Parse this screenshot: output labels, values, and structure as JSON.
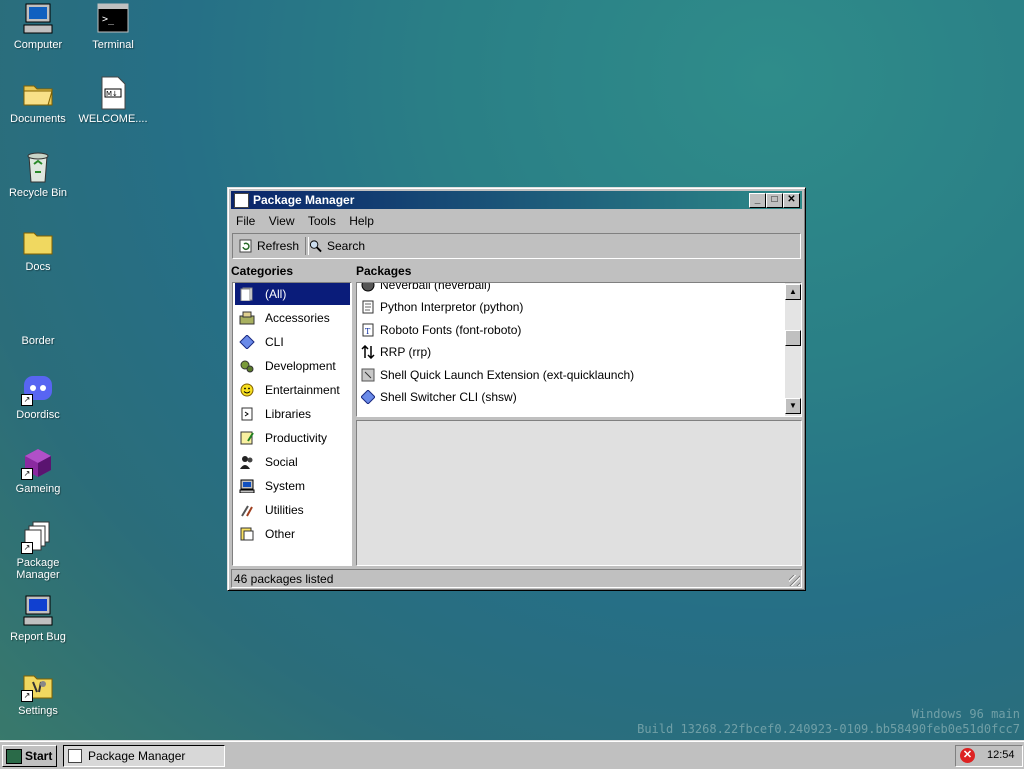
{
  "desktop": {
    "icons": [
      {
        "label": "Computer",
        "icon": "computer-icon"
      },
      {
        "label": "Terminal",
        "icon": "terminal-icon"
      },
      {
        "label": "Documents",
        "icon": "folder-open-icon"
      },
      {
        "label": "WELCOME....",
        "icon": "markdown-file-icon"
      },
      {
        "label": "Recycle Bin",
        "icon": "recycle-bin-icon"
      },
      {
        "label": "Docs",
        "icon": "folder-icon"
      },
      {
        "label": "Border",
        "icon": ""
      },
      {
        "label": "Doordisc",
        "icon": "discord-icon"
      },
      {
        "label": "Gameing",
        "icon": "game-cube-icon"
      },
      {
        "label": "Package Manager",
        "icon": "package-manager-icon"
      },
      {
        "label": "Report Bug",
        "icon": "computer-bug-icon"
      },
      {
        "label": "Settings",
        "icon": "settings-icon"
      }
    ]
  },
  "window": {
    "title": "Package Manager",
    "menu": [
      "File",
      "View",
      "Tools",
      "Help"
    ],
    "toolbar": {
      "refresh": "Refresh",
      "search": "Search"
    },
    "categories_header": "Categories",
    "packages_header": "Packages",
    "categories": [
      {
        "label": "(All)",
        "icon": "all-icon",
        "selected": true
      },
      {
        "label": "Accessories",
        "icon": "accessories-icon"
      },
      {
        "label": "CLI",
        "icon": "diamond-icon"
      },
      {
        "label": "Development",
        "icon": "development-icon"
      },
      {
        "label": "Entertainment",
        "icon": "smiley-icon"
      },
      {
        "label": "Libraries",
        "icon": "library-icon"
      },
      {
        "label": "Productivity",
        "icon": "notepad-icon"
      },
      {
        "label": "Social",
        "icon": "people-icon"
      },
      {
        "label": "System",
        "icon": "system-icon"
      },
      {
        "label": "Utilities",
        "icon": "utilities-icon"
      },
      {
        "label": "Other",
        "icon": "other-icon"
      }
    ],
    "packages": [
      {
        "label": "Neverball (neverball)",
        "icon": "ball-icon"
      },
      {
        "label": "Python Interpretor (python)",
        "icon": "document-icon"
      },
      {
        "label": "Roboto Fonts (font-roboto)",
        "icon": "font-icon"
      },
      {
        "label": "RRP (rrp)",
        "icon": "arrows-icon"
      },
      {
        "label": "Shell Quick Launch Extension (ext-quicklaunch)",
        "icon": "extension-icon"
      },
      {
        "label": "Shell Switcher CLI (shsw)",
        "icon": "diamond-icon"
      }
    ],
    "status": "46 packages listed"
  },
  "watermark": {
    "line1": "Windows 96 main",
    "line2": "Build 13268.22fbcef0.240923-0109.bb58490feb0e51d0fcc7"
  },
  "taskbar": {
    "start": "Start",
    "task": "Package Manager",
    "clock": "12:54"
  },
  "colors": {
    "title_start": "#0a246a",
    "title_end": "#2d8a88",
    "selection": "#0a1c7a",
    "desktop": "#2a7f86"
  }
}
